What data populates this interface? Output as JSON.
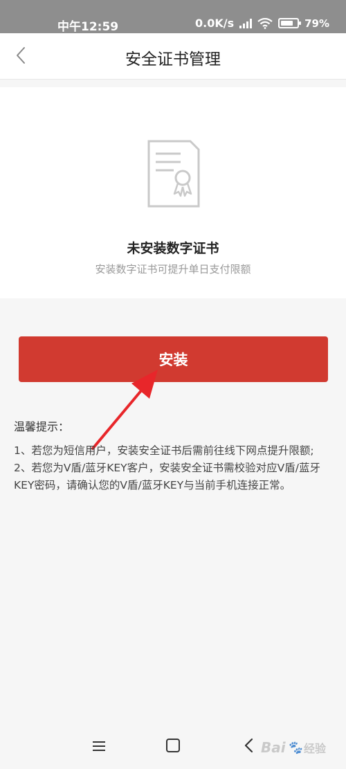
{
  "status_bar": {
    "time": "中午12:59",
    "net_speed": "0.0K/s",
    "battery": "79%",
    "battery_level": 0.79
  },
  "nav": {
    "title": "安全证书管理"
  },
  "cert": {
    "title": "未安装数字证书",
    "subtitle": "安装数字证书可提升单日支付限额"
  },
  "install_button": {
    "label": "安装"
  },
  "tips": {
    "title": "温馨提示：",
    "items": [
      "1、若您为短信用户，安装安全证书后需前往线下网点提升限额;",
      "2、若您为V盾/蓝牙KEY客户，安装安全证书需校验对应V盾/蓝牙KEY密码，请确认您的V盾/蓝牙KEY与当前手机连接正常。"
    ]
  },
  "icons": {
    "back": "chevron-left-icon",
    "cert": "certificate-icon",
    "menu": "menu-icon",
    "home": "home-square-icon",
    "system_back": "back-icon"
  },
  "colors": {
    "accent": "#d13a30",
    "status_bar": "#8e8e8e",
    "arrow": "#e8262a"
  },
  "watermark": {
    "text": "Bai",
    "sub": "经验"
  }
}
